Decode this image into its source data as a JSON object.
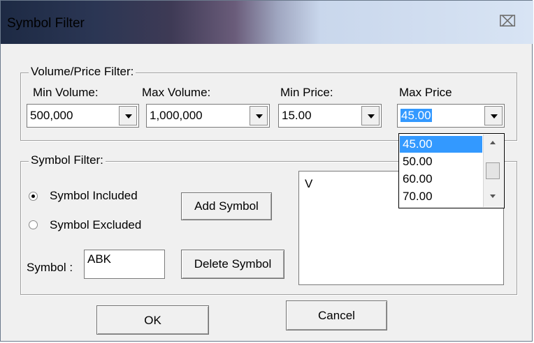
{
  "window": {
    "title": "Symbol Filter",
    "close_icon": "close-icon"
  },
  "volume_price": {
    "legend": "Volume/Price Filter:",
    "min_volume": {
      "label": "Min Volume:",
      "value": "500,000"
    },
    "max_volume": {
      "label": "Max Volume:",
      "value": "1,000,000"
    },
    "min_price": {
      "label": "Min Price:",
      "value": "15.00"
    },
    "max_price": {
      "label": "Max Price",
      "value": "45.00",
      "options": [
        "45.00",
        "50.00",
        "60.00",
        "70.00"
      ],
      "selected": "45.00"
    }
  },
  "symbol_filter": {
    "legend": "Symbol Filter:",
    "included_label": "Symbol Included",
    "excluded_label": "Symbol Excluded",
    "mode": "included",
    "symbol_label": "Symbol :",
    "symbol_value": "ABK",
    "add_label": "Add Symbol",
    "delete_label": "Delete Symbol",
    "symbols": [
      "V"
    ]
  },
  "buttons": {
    "ok": "OK",
    "cancel": "Cancel"
  }
}
